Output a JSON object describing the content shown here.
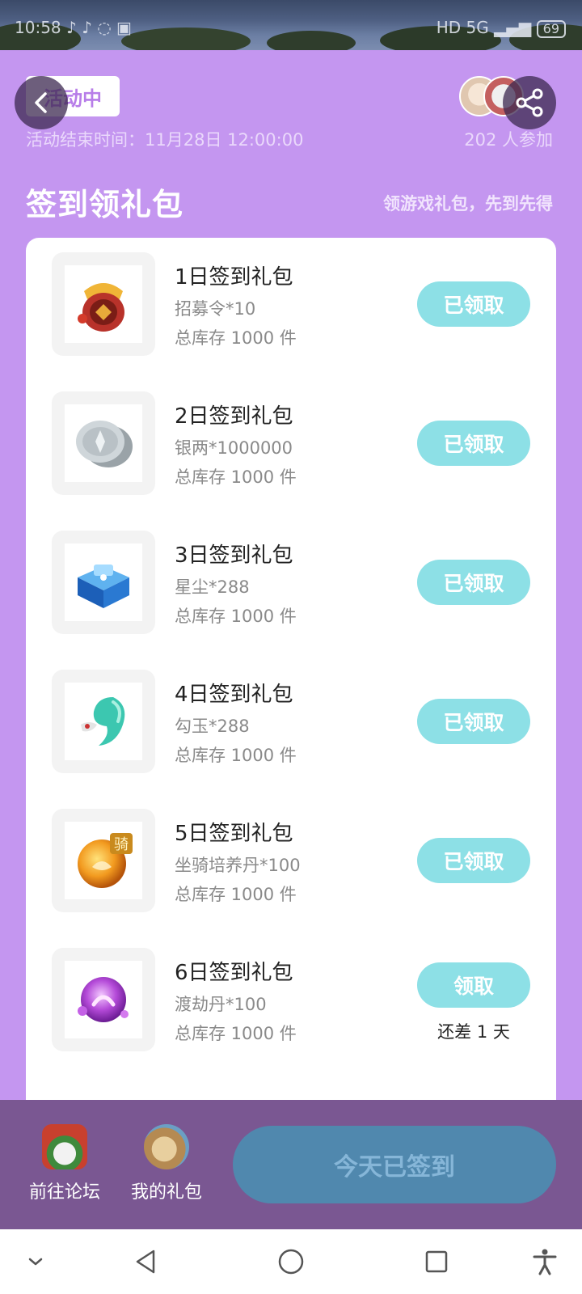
{
  "status_bar": {
    "time": "10:58",
    "network": "HD 5G",
    "battery": "69"
  },
  "header": {
    "status_pill": "活动中",
    "end_time": "活动结束时间：11月28日 12:00:00",
    "participants": "202 人参加"
  },
  "section": {
    "title": "签到领礼包",
    "subtitle": "领游戏礼包，先到先得"
  },
  "gifts": [
    {
      "name": "1日签到礼包",
      "item": "招募令*10",
      "stock": "总库存 1000 件",
      "button": "已领取"
    },
    {
      "name": "2日签到礼包",
      "item": "银两*1000000",
      "stock": "总库存 1000 件",
      "button": "已领取"
    },
    {
      "name": "3日签到礼包",
      "item": "星尘*288",
      "stock": "总库存 1000 件",
      "button": "已领取"
    },
    {
      "name": "4日签到礼包",
      "item": "勾玉*288",
      "stock": "总库存 1000 件",
      "button": "已领取"
    },
    {
      "name": "5日签到礼包",
      "item": "坐骑培养丹*100",
      "stock": "总库存 1000 件",
      "button": "已领取"
    },
    {
      "name": "6日签到礼包",
      "item": "渡劫丹*100",
      "stock": "总库存 1000 件",
      "button": "领取",
      "note": "还差 1 天"
    }
  ],
  "bottom_bar": {
    "forum_label": "前往论坛",
    "my_gifts_label": "我的礼包",
    "checkin_label": "今天已签到"
  },
  "colors": {
    "background": "#c496f0",
    "button": "#8de0e6",
    "bottom_bar": "#7a5792",
    "checkin_button": "#5088ae"
  }
}
